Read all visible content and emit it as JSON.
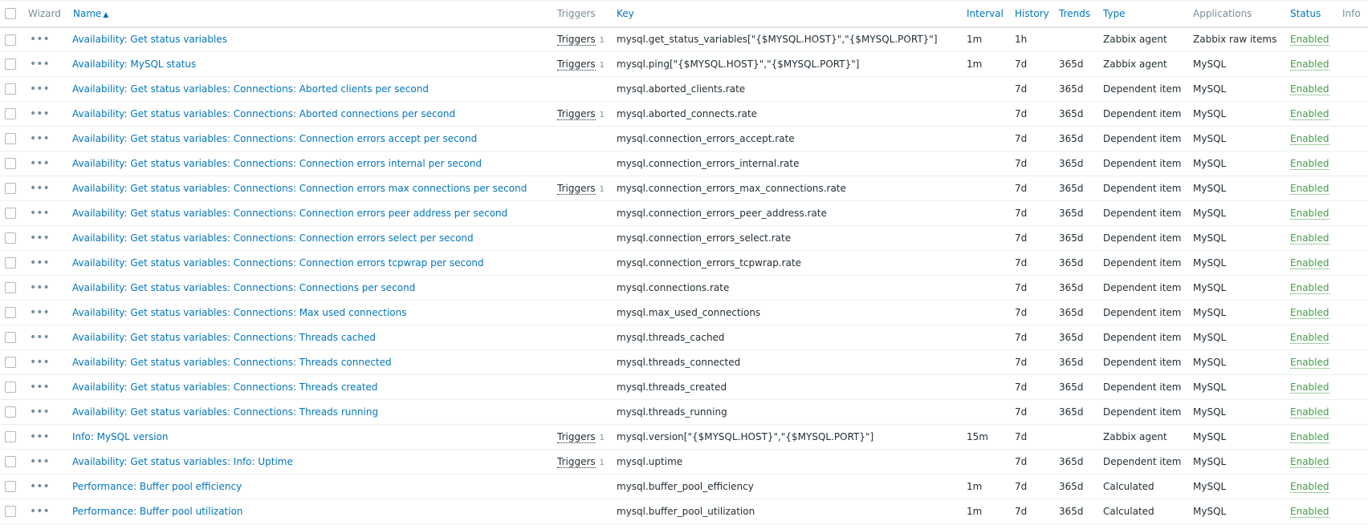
{
  "header": {
    "wizard": "Wizard",
    "name": "Name",
    "sort_arrow": "▲",
    "triggers": "Triggers",
    "key": "Key",
    "interval": "Interval",
    "history": "History",
    "trends": "Trends",
    "type": "Type",
    "applications": "Applications",
    "status": "Status",
    "info": "Info"
  },
  "colors": {
    "link": "#0275b8",
    "enabled": "#429e47",
    "header_text": "#768d99"
  },
  "rows": [
    {
      "name": "Availability: Get status variables",
      "triggers": "Triggers",
      "trigger_count": "1",
      "key": "mysql.get_status_variables[\"{$MYSQL.HOST}\",\"{$MYSQL.PORT}\"]",
      "interval": "1m",
      "history": "1h",
      "trends": "",
      "type": "Zabbix agent",
      "app": "Zabbix raw items",
      "status": "Enabled"
    },
    {
      "name": "Availability: MySQL status",
      "triggers": "Triggers",
      "trigger_count": "1",
      "key": "mysql.ping[\"{$MYSQL.HOST}\",\"{$MYSQL.PORT}\"]",
      "interval": "1m",
      "history": "7d",
      "trends": "365d",
      "type": "Zabbix agent",
      "app": "MySQL",
      "status": "Enabled"
    },
    {
      "name": "Availability: Get status variables: Connections: Aborted clients per second",
      "triggers": "",
      "trigger_count": "",
      "key": "mysql.aborted_clients.rate",
      "interval": "",
      "history": "7d",
      "trends": "365d",
      "type": "Dependent item",
      "app": "MySQL",
      "status": "Enabled"
    },
    {
      "name": "Availability: Get status variables: Connections: Aborted connections per second",
      "triggers": "Triggers",
      "trigger_count": "1",
      "key": "mysql.aborted_connects.rate",
      "interval": "",
      "history": "7d",
      "trends": "365d",
      "type": "Dependent item",
      "app": "MySQL",
      "status": "Enabled"
    },
    {
      "name": "Availability: Get status variables: Connections: Connection errors accept per second",
      "triggers": "",
      "trigger_count": "",
      "key": "mysql.connection_errors_accept.rate",
      "interval": "",
      "history": "7d",
      "trends": "365d",
      "type": "Dependent item",
      "app": "MySQL",
      "status": "Enabled"
    },
    {
      "name": "Availability: Get status variables: Connections: Connection errors internal per second",
      "triggers": "",
      "trigger_count": "",
      "key": "mysql.connection_errors_internal.rate",
      "interval": "",
      "history": "7d",
      "trends": "365d",
      "type": "Dependent item",
      "app": "MySQL",
      "status": "Enabled"
    },
    {
      "name": "Availability: Get status variables: Connections: Connection errors max connections per second",
      "triggers": "Triggers",
      "trigger_count": "1",
      "key": "mysql.connection_errors_max_connections.rate",
      "interval": "",
      "history": "7d",
      "trends": "365d",
      "type": "Dependent item",
      "app": "MySQL",
      "status": "Enabled"
    },
    {
      "name": "Availability: Get status variables: Connections: Connection errors peer address per second",
      "triggers": "",
      "trigger_count": "",
      "key": "mysql.connection_errors_peer_address.rate",
      "interval": "",
      "history": "7d",
      "trends": "365d",
      "type": "Dependent item",
      "app": "MySQL",
      "status": "Enabled"
    },
    {
      "name": "Availability: Get status variables: Connections: Connection errors select per second",
      "triggers": "",
      "trigger_count": "",
      "key": "mysql.connection_errors_select.rate",
      "interval": "",
      "history": "7d",
      "trends": "365d",
      "type": "Dependent item",
      "app": "MySQL",
      "status": "Enabled"
    },
    {
      "name": "Availability: Get status variables: Connections: Connection errors tcpwrap per second",
      "triggers": "",
      "trigger_count": "",
      "key": "mysql.connection_errors_tcpwrap.rate",
      "interval": "",
      "history": "7d",
      "trends": "365d",
      "type": "Dependent item",
      "app": "MySQL",
      "status": "Enabled"
    },
    {
      "name": "Availability: Get status variables: Connections: Connections per second",
      "triggers": "",
      "trigger_count": "",
      "key": "mysql.connections.rate",
      "interval": "",
      "history": "7d",
      "trends": "365d",
      "type": "Dependent item",
      "app": "MySQL",
      "status": "Enabled"
    },
    {
      "name": "Availability: Get status variables: Connections: Max used connections",
      "triggers": "",
      "trigger_count": "",
      "key": "mysql.max_used_connections",
      "interval": "",
      "history": "7d",
      "trends": "365d",
      "type": "Dependent item",
      "app": "MySQL",
      "status": "Enabled"
    },
    {
      "name": "Availability: Get status variables: Connections: Threads cached",
      "triggers": "",
      "trigger_count": "",
      "key": "mysql.threads_cached",
      "interval": "",
      "history": "7d",
      "trends": "365d",
      "type": "Dependent item",
      "app": "MySQL",
      "status": "Enabled"
    },
    {
      "name": "Availability: Get status variables: Connections: Threads connected",
      "triggers": "",
      "trigger_count": "",
      "key": "mysql.threads_connected",
      "interval": "",
      "history": "7d",
      "trends": "365d",
      "type": "Dependent item",
      "app": "MySQL",
      "status": "Enabled"
    },
    {
      "name": "Availability: Get status variables: Connections: Threads created",
      "triggers": "",
      "trigger_count": "",
      "key": "mysql.threads_created",
      "interval": "",
      "history": "7d",
      "trends": "365d",
      "type": "Dependent item",
      "app": "MySQL",
      "status": "Enabled"
    },
    {
      "name": "Availability: Get status variables: Connections: Threads running",
      "triggers": "",
      "trigger_count": "",
      "key": "mysql.threads_running",
      "interval": "",
      "history": "7d",
      "trends": "365d",
      "type": "Dependent item",
      "app": "MySQL",
      "status": "Enabled"
    },
    {
      "name": "Info: MySQL version",
      "triggers": "Triggers",
      "trigger_count": "1",
      "key": "mysql.version[\"{$MYSQL.HOST}\",\"{$MYSQL.PORT}\"]",
      "interval": "15m",
      "history": "7d",
      "trends": "",
      "type": "Zabbix agent",
      "app": "MySQL",
      "status": "Enabled"
    },
    {
      "name": "Availability: Get status variables: Info: Uptime",
      "triggers": "Triggers",
      "trigger_count": "1",
      "key": "mysql.uptime",
      "interval": "",
      "history": "7d",
      "trends": "365d",
      "type": "Dependent item",
      "app": "MySQL",
      "status": "Enabled"
    },
    {
      "name": "Performance: Buffer pool efficiency",
      "triggers": "",
      "trigger_count": "",
      "key": "mysql.buffer_pool_efficiency",
      "interval": "1m",
      "history": "7d",
      "trends": "365d",
      "type": "Calculated",
      "app": "MySQL",
      "status": "Enabled"
    },
    {
      "name": "Performance: Buffer pool utilization",
      "triggers": "",
      "trigger_count": "",
      "key": "mysql.buffer_pool_utilization",
      "interval": "1m",
      "history": "7d",
      "trends": "365d",
      "type": "Calculated",
      "app": "MySQL",
      "status": "Enabled"
    }
  ]
}
